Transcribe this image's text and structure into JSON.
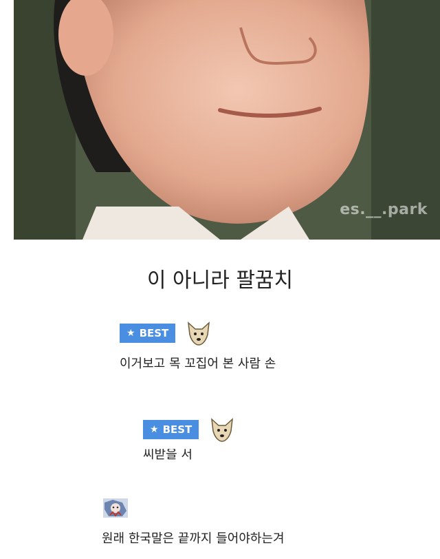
{
  "photo": {
    "watermark": "es.__.park"
  },
  "caption": "이 아니라 팔꿈치",
  "comments": [
    {
      "badge": "BEST",
      "text": "이거보고 목 꼬집어 본 사람 손"
    },
    {
      "badge": "BEST",
      "text": "씨받을 서"
    },
    {
      "text": "원래 한국말은 끝까지 들어야하는겨"
    }
  ],
  "colors": {
    "badge_bg": "#4a8ee2",
    "text": "#222222"
  }
}
